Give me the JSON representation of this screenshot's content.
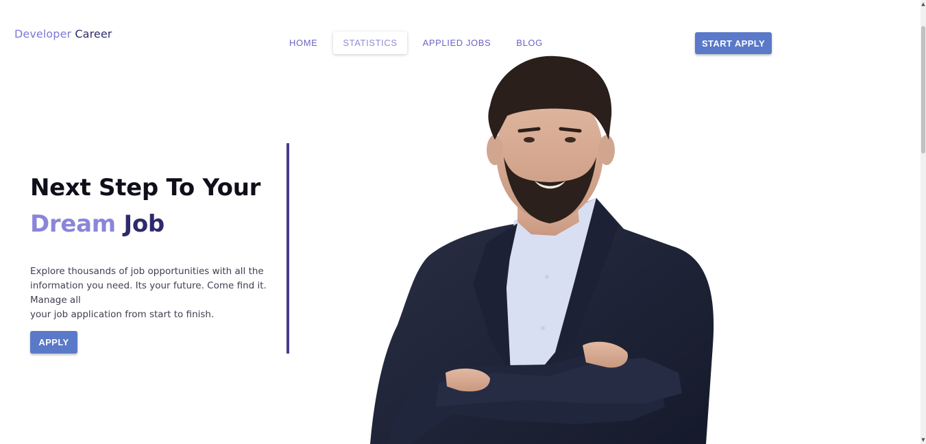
{
  "brand": {
    "part1": "Developer",
    "part2": "Career"
  },
  "nav": {
    "items": [
      {
        "label": "HOME"
      },
      {
        "label": "STATISTICS"
      },
      {
        "label": "APPLIED JOBS"
      },
      {
        "label": "BLOG"
      }
    ],
    "active_label": "STATISTICS"
  },
  "header": {
    "start_apply_label": "START APPLY"
  },
  "hero": {
    "title_line1": "Next Step To Your",
    "title_word_dream": "Dream",
    "title_word_job": "Job",
    "description_lines": [
      "Explore thousands of job opportunities with all the",
      "information you need. Its your future. Come find it.",
      "Manage all",
      "your job application from start to finish."
    ],
    "apply_label": "APPLY"
  },
  "colors": {
    "brand_light": "#7b7ad6",
    "brand_dark": "#2e2a6b",
    "button": "#5a79c8",
    "divider": "#4a3a8f"
  },
  "icons": {
    "scroll_up": "scroll-up-arrow-icon",
    "scroll_down": "scroll-down-arrow-icon"
  }
}
